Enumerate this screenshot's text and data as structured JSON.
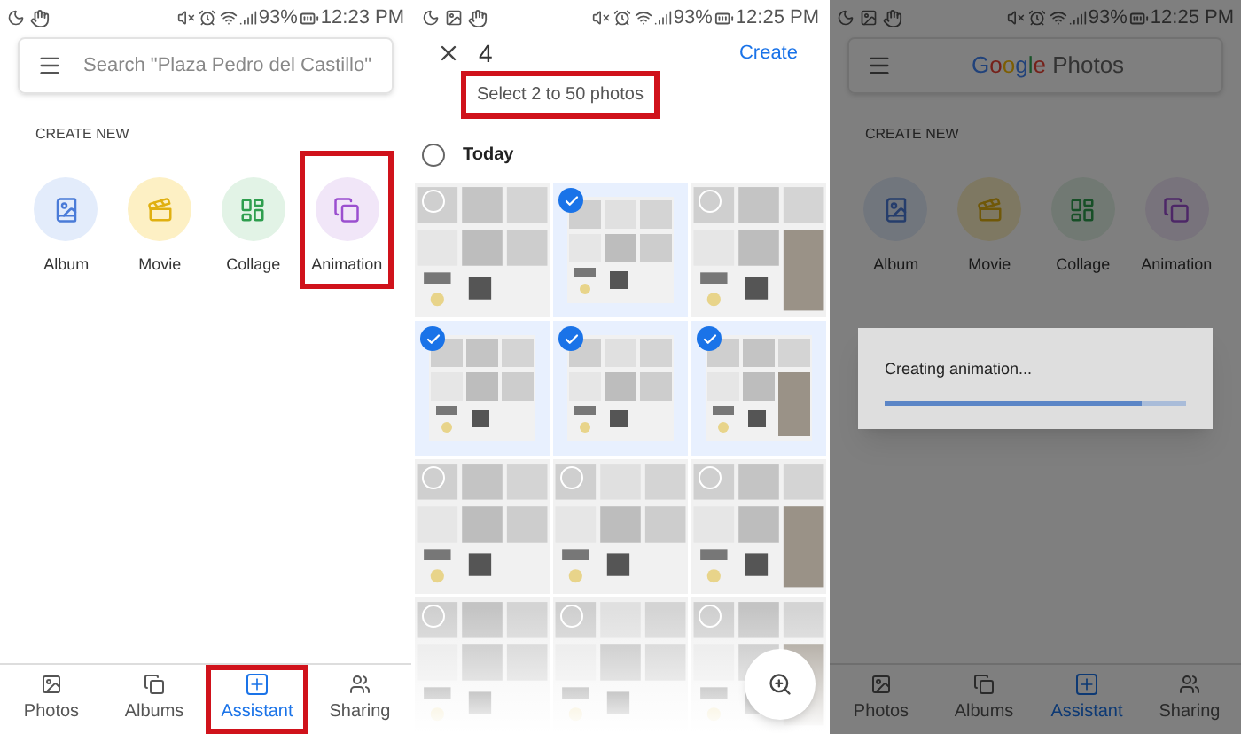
{
  "panels": [
    {
      "kind": "assistant",
      "status_bar": {
        "battery": "93%",
        "time": "12:23 PM"
      },
      "search": {
        "placeholder": "Search \"Plaza Pedro del Castillo\""
      },
      "section_title": "CREATE NEW",
      "create_items": [
        {
          "kind": "album",
          "label": "Album",
          "annotated": false
        },
        {
          "kind": "movie",
          "label": "Movie",
          "annotated": false
        },
        {
          "kind": "collage",
          "label": "Collage",
          "annotated": false
        },
        {
          "kind": "animation",
          "label": "Animation",
          "annotated": true
        }
      ],
      "bottom_nav": [
        {
          "kind": "photos",
          "label": "Photos",
          "selected": false,
          "annotated": false
        },
        {
          "kind": "albums",
          "label": "Albums",
          "selected": false,
          "annotated": false
        },
        {
          "kind": "assistant",
          "label": "Assistant",
          "selected": true,
          "annotated": true
        },
        {
          "kind": "sharing",
          "label": "Sharing",
          "selected": false,
          "annotated": false
        }
      ]
    },
    {
      "kind": "picker",
      "status_bar": {
        "battery": "93%",
        "time": "12:25 PM"
      },
      "count": "4",
      "action": "Create",
      "hint": {
        "text": "Select 2 to 50 photos",
        "annotated": true
      },
      "group": {
        "label": "Today",
        "selected": false
      },
      "photos": [
        {
          "selected": false
        },
        {
          "selected": true
        },
        {
          "selected": false
        },
        {
          "selected": true
        },
        {
          "selected": true
        },
        {
          "selected": true
        },
        {
          "selected": false
        },
        {
          "selected": false
        },
        {
          "selected": false
        },
        {
          "selected": false
        },
        {
          "selected": false
        },
        {
          "selected": false
        }
      ]
    },
    {
      "kind": "progress",
      "status_bar": {
        "battery": "93%",
        "time": "12:25 PM"
      },
      "logo": {
        "brand": "Google",
        "product": "Photos"
      },
      "section_title": "CREATE NEW",
      "create_items": [
        {
          "kind": "album",
          "label": "Album",
          "annotated": false
        },
        {
          "kind": "movie",
          "label": "Movie",
          "annotated": false
        },
        {
          "kind": "collage",
          "label": "Collage",
          "annotated": false
        },
        {
          "kind": "animation",
          "label": "Animation",
          "annotated": false
        }
      ],
      "bottom_nav": [
        {
          "kind": "photos",
          "label": "Photos",
          "selected": false,
          "annotated": false
        },
        {
          "kind": "albums",
          "label": "Albums",
          "selected": false,
          "annotated": false
        },
        {
          "kind": "assistant",
          "label": "Assistant",
          "selected": true,
          "annotated": false
        },
        {
          "kind": "sharing",
          "label": "Sharing",
          "selected": false,
          "annotated": false
        }
      ],
      "dialog": {
        "message": "Creating animation...",
        "level": 0.85
      }
    }
  ]
}
